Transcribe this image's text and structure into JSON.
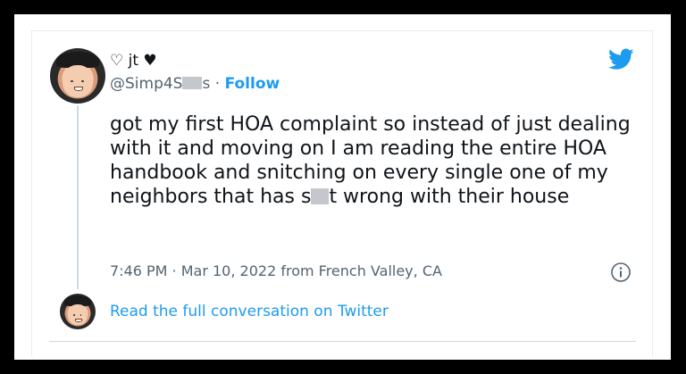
{
  "author": {
    "display_name": "♡ jt ♥",
    "handle_prefix": "@Simp4S",
    "handle_suffix": "s",
    "separator": "·",
    "follow_label": "Follow"
  },
  "tweet": {
    "text_before_censor": "got my first HOA complaint so instead of just dealing with it and moving on I am reading the entire HOA handbook and snitching on every single one of my neighbors that has s",
    "text_after_censor": "t wrong with their house",
    "timestamp": "7:46 PM · Mar 10, 2022 from French Valley, CA"
  },
  "footer": {
    "read_link": "Read the full conversation on Twitter"
  },
  "colors": {
    "link_blue": "#1d9bf0",
    "text": "#0f1419",
    "muted": "#536471",
    "background": "#000000"
  },
  "icons": [
    "twitter-bird-icon",
    "info-icon"
  ]
}
